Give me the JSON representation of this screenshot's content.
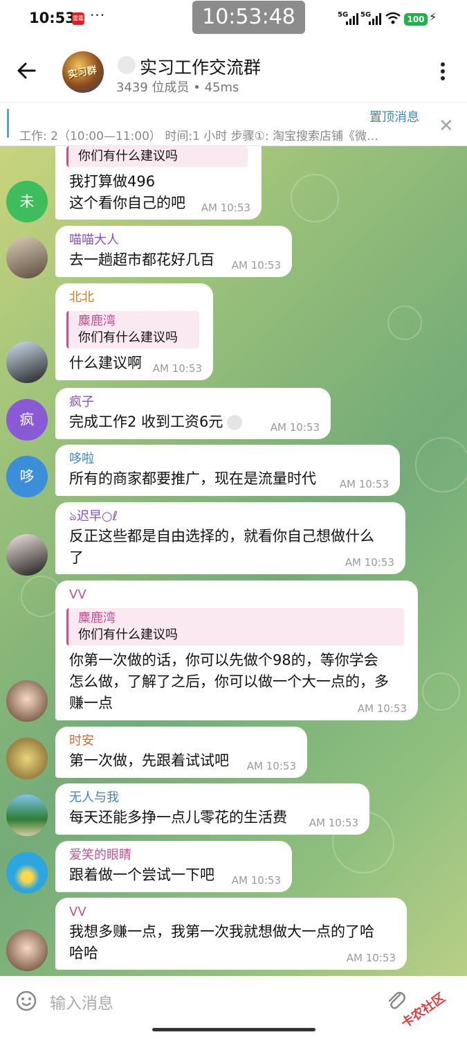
{
  "status_bar": {
    "time": "10:53",
    "app_badge": "雷霆",
    "more": "···",
    "clock": "10:53:48",
    "network1": "5G",
    "network2": "5G",
    "battery": "100"
  },
  "header": {
    "group_avatar_text": "实习群",
    "title": "实习工作交流群",
    "subtitle": "3439 位成员  •  45ms"
  },
  "pinned": {
    "label": "置顶消息",
    "text": "工作: 2（10:00—11:00） 时间:1 小时 步骤①: 淘宝搜索店铺《微…"
  },
  "messages": [
    {
      "sender": "",
      "reply_text": "你们有什么建议吗",
      "lines": [
        "我打算做496",
        "这个看你自己的吧"
      ],
      "time": "AM 10:53",
      "avatar": "未"
    },
    {
      "sender": "喵喵大人",
      "lines": [
        "去一趟超市都花好几百"
      ],
      "time": "AM 10:53"
    },
    {
      "sender": "北北",
      "reply_name": "麋鹿湾",
      "reply_text": "你们有什么建议吗",
      "lines": [
        "什么建议啊"
      ],
      "time": "AM 10:53"
    },
    {
      "sender": "疯子",
      "lines": [
        "完成工作2   收到工资6元"
      ],
      "time": "AM 10:53",
      "avatar": "疯"
    },
    {
      "sender": "哆啦",
      "lines": [
        "所有的商家都要推广，现在是流量时代"
      ],
      "time": "AM 10:53",
      "avatar": "哆"
    },
    {
      "sender": "ঌ迟早○ℓ",
      "lines": [
        "反正这些都是自由选择的，就看你自己想做什么",
        "了"
      ],
      "time": "AM 10:53"
    },
    {
      "sender": "VV",
      "reply_name": "麋鹿湾",
      "reply_text": "你们有什么建议吗",
      "lines": [
        "你第一次做的话，你可以先做个98的，等你学会",
        "怎么做，了解了之后，你可以做一个大一点的，多",
        "赚一点"
      ],
      "time": "AM 10:53"
    },
    {
      "sender": "时安",
      "lines": [
        "第一次做，先跟着试试吧"
      ],
      "time": "AM 10:53"
    },
    {
      "sender": "无人与我",
      "lines": [
        "每天还能多挣一点儿零花的生活费"
      ],
      "time": "AM 10:53"
    },
    {
      "sender": "爱笑的眼睛",
      "lines": [
        "跟着做一个尝试一下吧"
      ],
      "time": "AM 10:53"
    },
    {
      "sender": "VV",
      "lines": [
        "我想多赚一点，我第一次我就想做大一点的了哈",
        "哈哈"
      ],
      "time": "AM 10:53"
    }
  ],
  "input": {
    "placeholder": "输入消息",
    "watermark": "卡农社区"
  },
  "colors": {
    "pink": "#c5508e",
    "blue": "#3a86c9",
    "purple": "#8a4fc4",
    "orange": "#d07a2a",
    "green_avatar": "#3dbd5c"
  }
}
